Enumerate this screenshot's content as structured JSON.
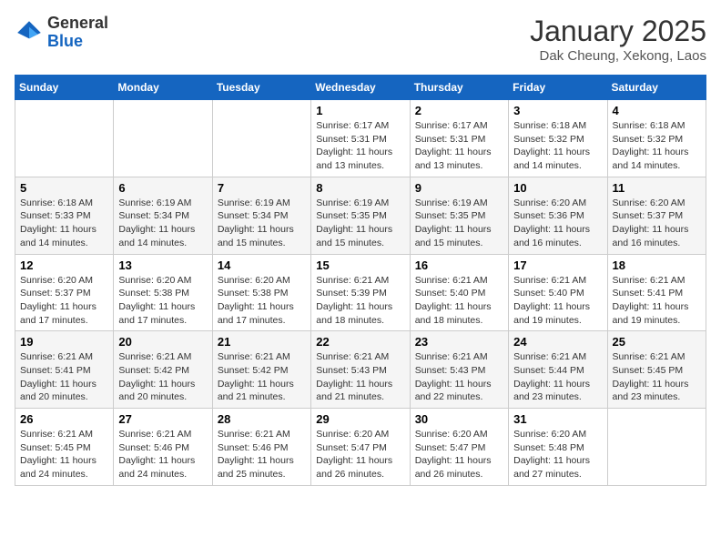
{
  "header": {
    "logo_general": "General",
    "logo_blue": "Blue",
    "month_title": "January 2025",
    "location": "Dak Cheung, Xekong, Laos"
  },
  "weekdays": [
    "Sunday",
    "Monday",
    "Tuesday",
    "Wednesday",
    "Thursday",
    "Friday",
    "Saturday"
  ],
  "weeks": [
    [
      {
        "day": "",
        "info": ""
      },
      {
        "day": "",
        "info": ""
      },
      {
        "day": "",
        "info": ""
      },
      {
        "day": "1",
        "info": "Sunrise: 6:17 AM\nSunset: 5:31 PM\nDaylight: 11 hours and 13 minutes."
      },
      {
        "day": "2",
        "info": "Sunrise: 6:17 AM\nSunset: 5:31 PM\nDaylight: 11 hours and 13 minutes."
      },
      {
        "day": "3",
        "info": "Sunrise: 6:18 AM\nSunset: 5:32 PM\nDaylight: 11 hours and 14 minutes."
      },
      {
        "day": "4",
        "info": "Sunrise: 6:18 AM\nSunset: 5:32 PM\nDaylight: 11 hours and 14 minutes."
      }
    ],
    [
      {
        "day": "5",
        "info": "Sunrise: 6:18 AM\nSunset: 5:33 PM\nDaylight: 11 hours and 14 minutes."
      },
      {
        "day": "6",
        "info": "Sunrise: 6:19 AM\nSunset: 5:34 PM\nDaylight: 11 hours and 14 minutes."
      },
      {
        "day": "7",
        "info": "Sunrise: 6:19 AM\nSunset: 5:34 PM\nDaylight: 11 hours and 15 minutes."
      },
      {
        "day": "8",
        "info": "Sunrise: 6:19 AM\nSunset: 5:35 PM\nDaylight: 11 hours and 15 minutes."
      },
      {
        "day": "9",
        "info": "Sunrise: 6:19 AM\nSunset: 5:35 PM\nDaylight: 11 hours and 15 minutes."
      },
      {
        "day": "10",
        "info": "Sunrise: 6:20 AM\nSunset: 5:36 PM\nDaylight: 11 hours and 16 minutes."
      },
      {
        "day": "11",
        "info": "Sunrise: 6:20 AM\nSunset: 5:37 PM\nDaylight: 11 hours and 16 minutes."
      }
    ],
    [
      {
        "day": "12",
        "info": "Sunrise: 6:20 AM\nSunset: 5:37 PM\nDaylight: 11 hours and 17 minutes."
      },
      {
        "day": "13",
        "info": "Sunrise: 6:20 AM\nSunset: 5:38 PM\nDaylight: 11 hours and 17 minutes."
      },
      {
        "day": "14",
        "info": "Sunrise: 6:20 AM\nSunset: 5:38 PM\nDaylight: 11 hours and 17 minutes."
      },
      {
        "day": "15",
        "info": "Sunrise: 6:21 AM\nSunset: 5:39 PM\nDaylight: 11 hours and 18 minutes."
      },
      {
        "day": "16",
        "info": "Sunrise: 6:21 AM\nSunset: 5:40 PM\nDaylight: 11 hours and 18 minutes."
      },
      {
        "day": "17",
        "info": "Sunrise: 6:21 AM\nSunset: 5:40 PM\nDaylight: 11 hours and 19 minutes."
      },
      {
        "day": "18",
        "info": "Sunrise: 6:21 AM\nSunset: 5:41 PM\nDaylight: 11 hours and 19 minutes."
      }
    ],
    [
      {
        "day": "19",
        "info": "Sunrise: 6:21 AM\nSunset: 5:41 PM\nDaylight: 11 hours and 20 minutes."
      },
      {
        "day": "20",
        "info": "Sunrise: 6:21 AM\nSunset: 5:42 PM\nDaylight: 11 hours and 20 minutes."
      },
      {
        "day": "21",
        "info": "Sunrise: 6:21 AM\nSunset: 5:42 PM\nDaylight: 11 hours and 21 minutes."
      },
      {
        "day": "22",
        "info": "Sunrise: 6:21 AM\nSunset: 5:43 PM\nDaylight: 11 hours and 21 minutes."
      },
      {
        "day": "23",
        "info": "Sunrise: 6:21 AM\nSunset: 5:43 PM\nDaylight: 11 hours and 22 minutes."
      },
      {
        "day": "24",
        "info": "Sunrise: 6:21 AM\nSunset: 5:44 PM\nDaylight: 11 hours and 23 minutes."
      },
      {
        "day": "25",
        "info": "Sunrise: 6:21 AM\nSunset: 5:45 PM\nDaylight: 11 hours and 23 minutes."
      }
    ],
    [
      {
        "day": "26",
        "info": "Sunrise: 6:21 AM\nSunset: 5:45 PM\nDaylight: 11 hours and 24 minutes."
      },
      {
        "day": "27",
        "info": "Sunrise: 6:21 AM\nSunset: 5:46 PM\nDaylight: 11 hours and 24 minutes."
      },
      {
        "day": "28",
        "info": "Sunrise: 6:21 AM\nSunset: 5:46 PM\nDaylight: 11 hours and 25 minutes."
      },
      {
        "day": "29",
        "info": "Sunrise: 6:20 AM\nSunset: 5:47 PM\nDaylight: 11 hours and 26 minutes."
      },
      {
        "day": "30",
        "info": "Sunrise: 6:20 AM\nSunset: 5:47 PM\nDaylight: 11 hours and 26 minutes."
      },
      {
        "day": "31",
        "info": "Sunrise: 6:20 AM\nSunset: 5:48 PM\nDaylight: 11 hours and 27 minutes."
      },
      {
        "day": "",
        "info": ""
      }
    ]
  ]
}
